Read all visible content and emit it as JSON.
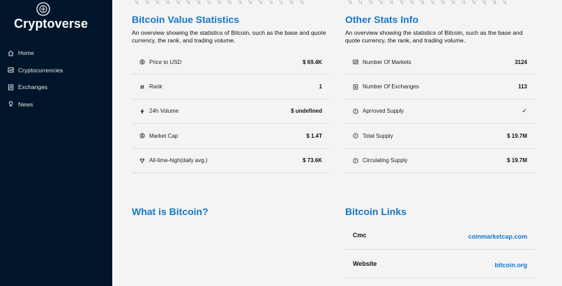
{
  "sidebar": {
    "brand": "Cryptoverse",
    "items": [
      {
        "label": "Home",
        "icon": "home-icon"
      },
      {
        "label": "Cryptocurrencies",
        "icon": "fund-icon"
      },
      {
        "label": "Exchanges",
        "icon": "exchange-icon"
      },
      {
        "label": "News",
        "icon": "bulb-icon"
      }
    ]
  },
  "value_stats": {
    "title": "Bitcoin Value Statistics",
    "description": "An overview showing the statistics of Bitcoin, such as the base and quote currency, the rank, and trading volume.",
    "rows": [
      {
        "label": "Price to USD",
        "value": "$ 69.4K",
        "icon": "dollar-circle-icon"
      },
      {
        "label": "Rank",
        "value": "1",
        "icon": "number-icon"
      },
      {
        "label": "24h Volume",
        "value": "$ undefined",
        "icon": "thunderbolt-icon"
      },
      {
        "label": "Market Cap",
        "value": "$ 1.4T",
        "icon": "dollar-circle-icon"
      },
      {
        "label": "All-time-high(daily avg.)",
        "value": "$ 73.6K",
        "icon": "trophy-icon"
      }
    ]
  },
  "other_stats": {
    "title": "Other Stats Info",
    "description": "An overview showing the statistics of Bitcoin, such as the base and quote currency, the rank, and trading volume.",
    "rows": [
      {
        "label": "Number Of Markets",
        "value": "3124",
        "icon": "fund-icon"
      },
      {
        "label": "Number Of Exchanges",
        "value": "113",
        "icon": "money-collect-icon"
      },
      {
        "label": "Aprroved Supply",
        "value": "✓",
        "icon": "exclamation-circle-icon"
      },
      {
        "label": "Total Supply",
        "value": "$ 19.7M",
        "icon": "exclamation-circle-icon"
      },
      {
        "label": "Circulating Supply",
        "value": "$ 19.7M",
        "icon": "exclamation-circle-icon"
      }
    ]
  },
  "about": {
    "title": "What is Bitcoin?"
  },
  "links": {
    "title": "Bitcoin Links",
    "rows": [
      {
        "name": "Cmc",
        "url": "coinmarketcap.com"
      },
      {
        "name": "Website",
        "url": "bitcoin.org"
      }
    ]
  },
  "colors": {
    "sidebar_bg": "#001529",
    "accent": "#1677c9",
    "page_bg": "#f4f4f4"
  }
}
